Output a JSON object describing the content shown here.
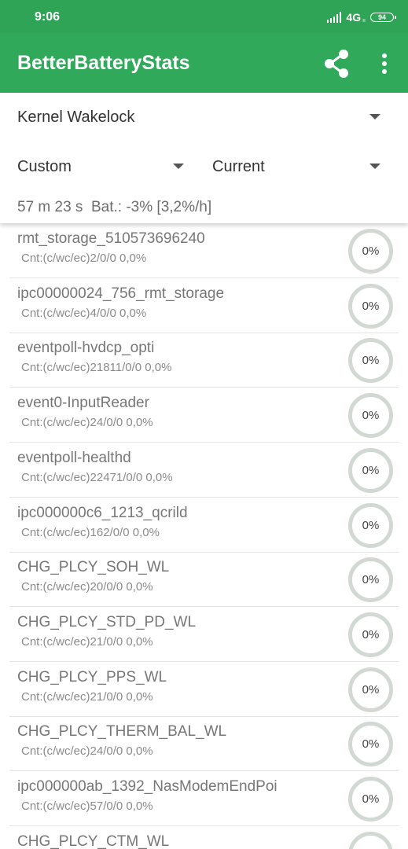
{
  "status_bar": {
    "time": "9:06",
    "network": "4G",
    "network_sub": "ıı",
    "battery": "94"
  },
  "app_bar": {
    "title": "BetterBatteryStats",
    "background": "#31a95b",
    "share_icon": "share-icon",
    "more_icon": "more-vert-icon"
  },
  "filters": {
    "stat_type": "Kernel Wakelock",
    "reference_from": "Custom",
    "reference_to": "Current"
  },
  "summary": "57 m 23 s  Bat.: -3% [3,2%/h]",
  "wakelocks": [
    {
      "name": "rmt_storage_510573696240",
      "count": "Cnt:(c/wc/ec)2/0/0 0,0%",
      "percent": "0%"
    },
    {
      "name": "ipc00000024_756_rmt_storage",
      "count": "Cnt:(c/wc/ec)4/0/0 0,0%",
      "percent": "0%"
    },
    {
      "name": "eventpoll-hvdcp_opti",
      "count": "Cnt:(c/wc/ec)21811/0/0 0,0%",
      "percent": "0%"
    },
    {
      "name": "event0-InputReader",
      "count": "Cnt:(c/wc/ec)24/0/0 0,0%",
      "percent": "0%"
    },
    {
      "name": "eventpoll-healthd",
      "count": "Cnt:(c/wc/ec)22471/0/0 0,0%",
      "percent": "0%"
    },
    {
      "name": "ipc000000c6_1213_qcrild",
      "count": "Cnt:(c/wc/ec)162/0/0 0,0%",
      "percent": "0%"
    },
    {
      "name": "CHG_PLCY_SOH_WL",
      "count": "Cnt:(c/wc/ec)20/0/0 0,0%",
      "percent": "0%"
    },
    {
      "name": "CHG_PLCY_STD_PD_WL",
      "count": "Cnt:(c/wc/ec)21/0/0 0,0%",
      "percent": "0%"
    },
    {
      "name": "CHG_PLCY_PPS_WL",
      "count": "Cnt:(c/wc/ec)21/0/0 0,0%",
      "percent": "0%"
    },
    {
      "name": "CHG_PLCY_THERM_BAL_WL",
      "count": "Cnt:(c/wc/ec)24/0/0 0,0%",
      "percent": "0%"
    },
    {
      "name": "ipc000000ab_1392_NasModemEndPoi",
      "count": "Cnt:(c/wc/ec)57/0/0 0,0%",
      "percent": "0%"
    },
    {
      "name": "CHG_PLCY_CTM_WL",
      "count": "",
      "percent": ""
    }
  ]
}
